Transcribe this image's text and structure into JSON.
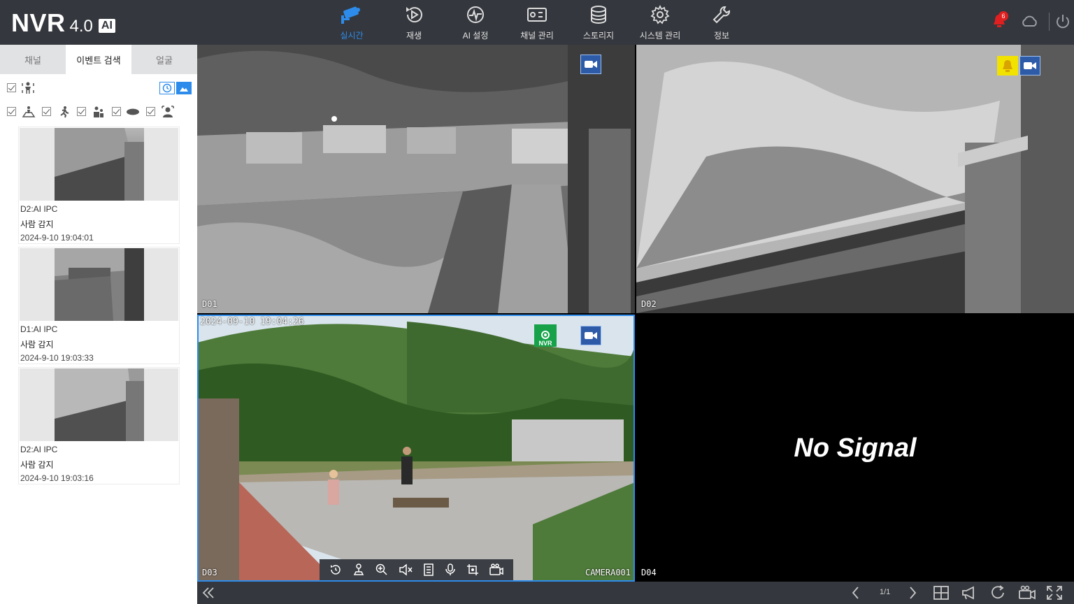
{
  "app": {
    "logo": "NVR",
    "version": "4.0",
    "ai_badge": "AI"
  },
  "nav": [
    {
      "label": "실시간",
      "icon": "camera-icon",
      "active": true
    },
    {
      "label": "재생",
      "icon": "playback-icon",
      "active": false
    },
    {
      "label": "AI 설정",
      "icon": "ai-settings-icon",
      "active": false
    },
    {
      "label": "채널 관리",
      "icon": "channel-icon",
      "active": false
    },
    {
      "label": "스토리지",
      "icon": "storage-icon",
      "active": false
    },
    {
      "label": "시스템 관리",
      "icon": "gear-icon",
      "active": false
    },
    {
      "label": "정보",
      "icon": "wrench-icon",
      "active": false
    }
  ],
  "notifications": {
    "count": "6"
  },
  "sidebar": {
    "tabs": [
      {
        "label": "채널",
        "active": false
      },
      {
        "label": "이벤트 검색",
        "active": true
      },
      {
        "label": "얼굴",
        "active": false
      }
    ],
    "events": [
      {
        "channel": "D2:AI IPC",
        "type": "사람 감지",
        "time": "2024-9-10  19:04:01"
      },
      {
        "channel": "D1:AI IPC",
        "type": "사람 감지",
        "time": "2024-9-10  19:03:33"
      },
      {
        "channel": "D2:AI IPC",
        "type": "사람 감지",
        "time": "2024-9-10  19:03:16"
      }
    ]
  },
  "cameras": {
    "d01": {
      "label": "D01"
    },
    "d02": {
      "label": "D02"
    },
    "d03": {
      "label": "D03",
      "timestamp": "2024-09-10 19:04:26",
      "name": "CAMERA001",
      "nvr_icon_label": "NVR"
    },
    "d04": {
      "label": "D04",
      "status": "No Signal"
    }
  },
  "pager": {
    "text": "1/1"
  },
  "colors": {
    "accent": "#2d8ceb",
    "topbar": "#34373d",
    "alarm": "#f2e200",
    "record": "#2d5ba8"
  }
}
